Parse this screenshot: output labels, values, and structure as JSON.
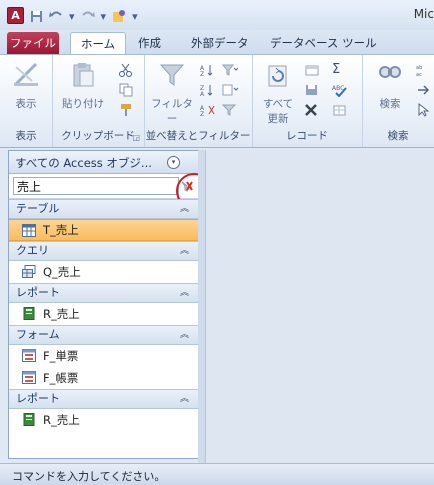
{
  "title_bar": {
    "app_icon_letter": "A",
    "app_title": "Mic"
  },
  "tabs": [
    {
      "label": "ファイル"
    },
    {
      "label": "ホーム"
    },
    {
      "label": "作成"
    },
    {
      "label": "外部データ"
    },
    {
      "label": "データベース ツール"
    }
  ],
  "ribbon": {
    "groups": [
      {
        "label": "表示",
        "buttons": [
          "表示"
        ]
      },
      {
        "label": "クリップボード",
        "buttons": [
          "貼り付け"
        ]
      },
      {
        "label": "並べ替えとフィルター",
        "buttons": [
          "フィルター"
        ]
      },
      {
        "label": "レコード",
        "buttons": [
          "すべて",
          "更新"
        ]
      },
      {
        "label": "検索",
        "buttons": [
          "検索"
        ]
      }
    ]
  },
  "nav_pane": {
    "title": "すべての Access オブジ...",
    "search_value": "売上",
    "sections": [
      {
        "label": "テーブル",
        "items": [
          {
            "label": "T_売上",
            "selected": true
          }
        ]
      },
      {
        "label": "クエリ",
        "items": [
          {
            "label": "Q_売上"
          }
        ]
      },
      {
        "label": "レポート",
        "items": [
          {
            "label": "R_売上"
          }
        ]
      },
      {
        "label": "フォーム",
        "items": [
          {
            "label": "F_単票"
          },
          {
            "label": "F_帳票"
          }
        ]
      },
      {
        "label": "レポート",
        "items": [
          {
            "label": "R_売上"
          }
        ]
      }
    ]
  },
  "status_bar": {
    "text": "コマンドを入力してください。"
  },
  "colors": {
    "accent": "#a8213a",
    "selection": "#fbbc5e",
    "annotation_circle": "#e0141e"
  }
}
